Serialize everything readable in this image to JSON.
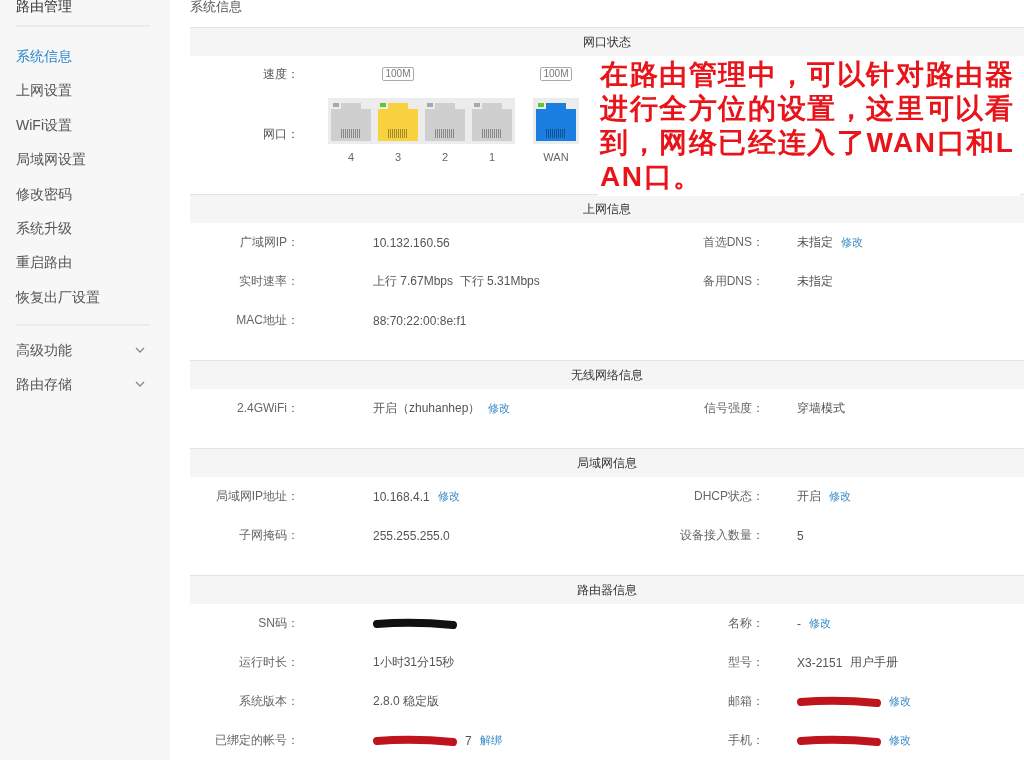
{
  "sidebar": {
    "title": "路由管理",
    "items": [
      {
        "label": "系统信息",
        "selected": true
      },
      {
        "label": "上网设置",
        "selected": false
      },
      {
        "label": "WiFi设置",
        "selected": false
      },
      {
        "label": "局域网设置",
        "selected": false
      },
      {
        "label": "修改密码",
        "selected": false
      },
      {
        "label": "系统升级",
        "selected": false
      },
      {
        "label": "重启路由",
        "selected": false
      },
      {
        "label": "恢复出厂设置",
        "selected": false
      }
    ],
    "groups": [
      {
        "label": "高级功能",
        "expanded": false
      },
      {
        "label": "路由存储",
        "expanded": false
      }
    ]
  },
  "page_title": "系统信息",
  "port_panel": {
    "title": "网口状态",
    "speed_label": "速度：",
    "port_label": "网口：",
    "groups": [
      {
        "ports": [
          {
            "label": "4",
            "color": "#cfcfcf",
            "connected": false
          },
          {
            "label": "3",
            "color": "#f7d23e",
            "connected": true,
            "speed": "100M"
          },
          {
            "label": "2",
            "color": "#cfcfcf",
            "connected": false
          },
          {
            "label": "1",
            "color": "#cfcfcf",
            "connected": false
          }
        ]
      },
      {
        "ports": [
          {
            "label": "WAN",
            "color": "#1a7fe0",
            "connected": true,
            "speed": "100M"
          }
        ]
      }
    ]
  },
  "sections": [
    {
      "title": "上网信息",
      "rows": [
        {
          "left": {
            "label": "广域网IP：",
            "parts": [
              {
                "kind": "text",
                "text": "10.132.160.56"
              }
            ]
          },
          "right": {
            "label": "首选DNS：",
            "parts": [
              {
                "kind": "text",
                "text": "未指定"
              },
              {
                "kind": "link",
                "text": "修改"
              }
            ]
          }
        },
        {
          "left": {
            "label": "实时速率：",
            "parts": [
              {
                "kind": "text",
                "text": "上行 7.67Mbps  下行 5.31Mbps"
              }
            ]
          },
          "right": {
            "label": "备用DNS：",
            "parts": [
              {
                "kind": "text",
                "text": "未指定"
              }
            ]
          }
        },
        {
          "left": {
            "label": "MAC地址：",
            "parts": [
              {
                "kind": "text",
                "text": "88:70:22:00:8e:f1"
              }
            ]
          }
        }
      ]
    },
    {
      "title": "无线网络信息",
      "rows": [
        {
          "left": {
            "label": "2.4GWiFi：",
            "parts": [
              {
                "kind": "text",
                "text": "开启（zhuhanhep）"
              },
              {
                "kind": "link",
                "text": "修改"
              }
            ]
          },
          "right": {
            "label": "信号强度：",
            "parts": [
              {
                "kind": "text",
                "text": "穿墙模式"
              }
            ]
          }
        }
      ]
    },
    {
      "title": "局域网信息",
      "rows": [
        {
          "left": {
            "label": "局域网IP地址：",
            "parts": [
              {
                "kind": "text",
                "text": "10.168.4.1"
              },
              {
                "kind": "link",
                "text": "修改"
              }
            ]
          },
          "right": {
            "label": "DHCP状态：",
            "parts": [
              {
                "kind": "text",
                "text": "开启"
              },
              {
                "kind": "link",
                "text": "修改"
              }
            ]
          }
        },
        {
          "left": {
            "label": "子网掩码：",
            "parts": [
              {
                "kind": "text",
                "text": "255.255.255.0"
              }
            ]
          },
          "right": {
            "label": "设备接入数量：",
            "parts": [
              {
                "kind": "text",
                "text": "5"
              }
            ]
          }
        }
      ]
    },
    {
      "title": "路由器信息",
      "rows": [
        {
          "left": {
            "label": "SN码：",
            "parts": [
              {
                "kind": "redacted",
                "color": "#111111"
              }
            ]
          },
          "right": {
            "label": "名称：",
            "parts": [
              {
                "kind": "text",
                "text": "-"
              },
              {
                "kind": "link",
                "text": "修改"
              }
            ]
          }
        },
        {
          "left": {
            "label": "运行时长：",
            "parts": [
              {
                "kind": "text",
                "text": "1小时31分15秒"
              }
            ]
          },
          "right": {
            "label": "型号：",
            "parts": [
              {
                "kind": "text",
                "text": "X3-2151"
              },
              {
                "kind": "text",
                "text": "用户手册"
              }
            ]
          }
        },
        {
          "left": {
            "label": "系统版本：",
            "parts": [
              {
                "kind": "text",
                "text": "2.8.0 稳定版"
              }
            ]
          },
          "right": {
            "label": "邮箱：",
            "parts": [
              {
                "kind": "redacted",
                "color": "#c0141c"
              },
              {
                "kind": "link",
                "text": "修改"
              }
            ]
          }
        },
        {
          "left": {
            "label": "已绑定的帐号：",
            "parts": [
              {
                "kind": "redacted",
                "color": "#c0141c"
              },
              {
                "kind": "text",
                "text": "7"
              },
              {
                "kind": "link",
                "text": "解绑"
              }
            ]
          },
          "right": {
            "label": "手机：",
            "parts": [
              {
                "kind": "redacted",
                "color": "#c0141c"
              },
              {
                "kind": "link",
                "text": "修改"
              }
            ]
          }
        }
      ]
    }
  ],
  "annotation": {
    "text": "在路由管理中，可以针对路由器进行全方位的设置，这里可以看到，网络已经连入了WAN口和LAN口。"
  }
}
